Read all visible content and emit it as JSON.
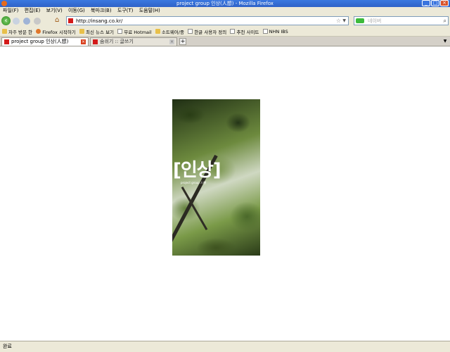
{
  "window": {
    "title": "project group 인상(人想) - Mozilla Firefox"
  },
  "menu": [
    "파일(F)",
    "편집(E)",
    "보기(V)",
    "이동(G)",
    "북마크(B)",
    "도구(T)",
    "도움말(H)"
  ],
  "nav": {
    "url": "http://insang.co.kr/",
    "search_placeholder": "네이버"
  },
  "bookmarks": [
    {
      "label": "자주 방문 한",
      "icon": "folder-icon"
    },
    {
      "label": "Firefox 시작하기",
      "icon": "firefox-icon"
    },
    {
      "label": "최신 뉴스 보기",
      "icon": "folder-icon"
    },
    {
      "label": "무료 Hotmail",
      "icon": "page-icon"
    },
    {
      "label": "소트웨어/중",
      "icon": "folder-icon"
    },
    {
      "label": "한글 사용자 정의",
      "icon": "page-icon"
    },
    {
      "label": "추천 사이트",
      "icon": "page-icon"
    },
    {
      "label": "NHN IBS",
      "icon": "page-icon"
    }
  ],
  "tabs": [
    {
      "label": "project group 인상(人想)",
      "active": true
    },
    {
      "label": "숨쉬기 :: 글쓰기",
      "active": false
    }
  ],
  "content": {
    "logo_text": "[인상]",
    "sub_text": "project group 人想"
  },
  "status": "완료",
  "colors": {
    "titlebar": "#2f63c8",
    "chrome": "#ece9d8",
    "favicon": "#d31a1a"
  }
}
